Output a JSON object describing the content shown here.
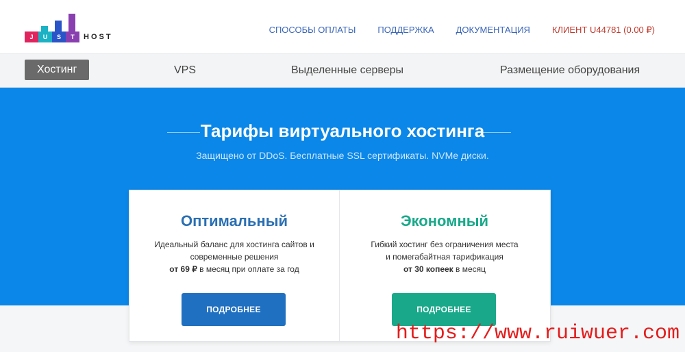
{
  "colors": {
    "accent": "#0a87e8",
    "optimal": "#2a6fb3",
    "econom": "#19a98a",
    "client": "#c0392b",
    "nav": "#3a66b8"
  },
  "logo": {
    "letters": [
      "J",
      "U",
      "S",
      "T"
    ],
    "host": "HOST"
  },
  "topnav": {
    "payment": "СПОСОБЫ ОПЛАТЫ",
    "support": "ПОДДЕРЖКА",
    "docs": "ДОКУМЕНТАЦИЯ",
    "client": "КЛИЕНТ U44781 (0.00 ₽)"
  },
  "subnav": {
    "hosting": "Хостинг",
    "vps": "VPS",
    "dedicated": "Выделенные серверы",
    "colocation": "Размещение оборудования"
  },
  "hero": {
    "title": "Тарифы виртуального хостинга",
    "subtitle": "Защищено от DDoS. Бесплатные SSL сертификаты. NVMe диски."
  },
  "cards": [
    {
      "title": "Оптимальный",
      "desc1": "Идеальный баланс для хостинга сайтов и",
      "desc2": "современные решения",
      "price_bold": "от 69 ₽",
      "price_rest": " в месяц при оплате за год",
      "button": "ПОДРОБНЕЕ"
    },
    {
      "title": "Экономный",
      "desc1": "Гибкий хостинг без ограничения места",
      "desc2": "и помегабайтная тарификация",
      "price_bold": "от 30 копеек",
      "price_rest": " в месяц",
      "button": "ПОДРОБНЕЕ"
    }
  ],
  "watermark": "https://www.ruiwuer.com"
}
